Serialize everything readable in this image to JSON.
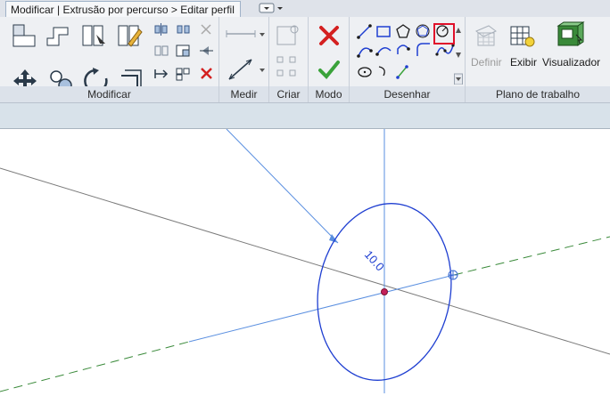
{
  "tabs": {
    "active_label": "Modificar | Extrusão por percurso > Editar perfil"
  },
  "panels": {
    "modify": "Modificar",
    "measure": "Medir",
    "create": "Criar",
    "mode": "Modo",
    "draw": "Desenhar",
    "work_plane": "Plano de trabalho"
  },
  "work_plane_buttons": {
    "define": "Definir",
    "show": "Exibir",
    "viewer": "Visualizador"
  },
  "canvas": {
    "dimension_label": "10.0"
  },
  "colors": {
    "sketch_blue": "#1f3fd1",
    "ref_line": "#5a8fe0",
    "highlight_red": "#e0102a",
    "accept_green": "#3aa23a",
    "cancel_red": "#d42020"
  }
}
